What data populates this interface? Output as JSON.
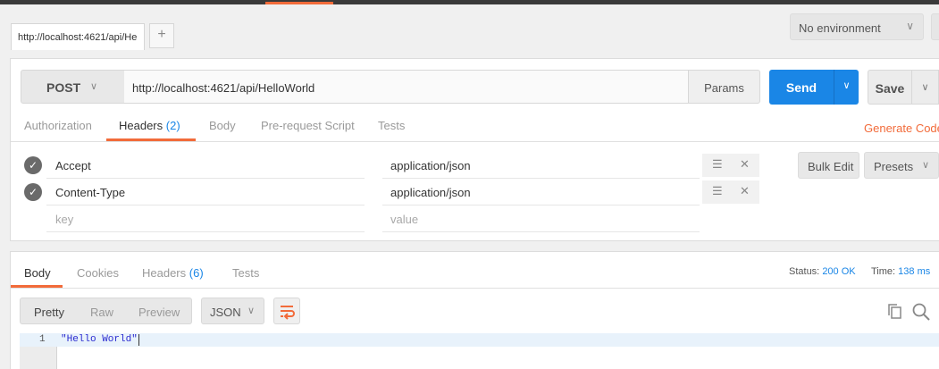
{
  "tabs": {
    "active_tab_title": "http://localhost:4621/api/He",
    "add_tab_label": "+"
  },
  "environment": {
    "selected": "No environment"
  },
  "request": {
    "method": "POST",
    "url": "http://localhost:4621/api/HelloWorld",
    "params_label": "Params",
    "send_label": "Send",
    "save_label": "Save",
    "tabs": [
      {
        "label": "Authorization",
        "count": ""
      },
      {
        "label": "Headers",
        "count": "(2)"
      },
      {
        "label": "Body",
        "count": ""
      },
      {
        "label": "Pre-request Script",
        "count": ""
      },
      {
        "label": "Tests",
        "count": ""
      }
    ],
    "generate_code_label": "Generate Code",
    "headers": [
      {
        "key": "Accept",
        "value": "application/json",
        "enabled": true
      },
      {
        "key": "Content-Type",
        "value": "application/json",
        "enabled": true
      }
    ],
    "new_row": {
      "key_placeholder": "key",
      "value_placeholder": "value"
    },
    "bulk_edit_label": "Bulk Edit",
    "presets_label": "Presets"
  },
  "response": {
    "tabs": [
      {
        "label": "Body",
        "count": ""
      },
      {
        "label": "Cookies",
        "count": ""
      },
      {
        "label": "Headers",
        "count": "(6)"
      },
      {
        "label": "Tests",
        "count": ""
      }
    ],
    "status_label": "Status:",
    "status_value": "200 OK",
    "time_label": "Time:",
    "time_value": "138 ms",
    "view_modes": [
      "Pretty",
      "Raw",
      "Preview"
    ],
    "format": "JSON",
    "lines": [
      {
        "num": "1",
        "text": "\"Hello World\""
      }
    ]
  },
  "colors": {
    "accent": "#f26b3a",
    "primary": "#1a86e6"
  }
}
